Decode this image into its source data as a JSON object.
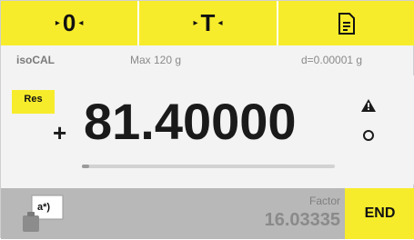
{
  "topbar": {
    "zero_label": "0",
    "tare_label": "T",
    "print_icon": "document-print-icon"
  },
  "info": {
    "mode": "isoCAL",
    "max": "Max 120 g",
    "readability": "d=0.00001 g"
  },
  "result": {
    "badge": "Res",
    "sign": "+",
    "value": "81.40000",
    "warning_icon": "warning-triangle-icon",
    "stability_icon": "stability-circle-icon",
    "progress_fraction": 0.03
  },
  "bottombar": {
    "weight_icon": "weight-function-icon",
    "weight_icon_text": "a*)",
    "factor_label": "Factor",
    "factor_value": "16.03335",
    "end_label": "END"
  },
  "colors": {
    "accent_yellow": "#f7ec2b",
    "background": "#f3f3f3",
    "bottom_bar": "#b8b8b8"
  }
}
